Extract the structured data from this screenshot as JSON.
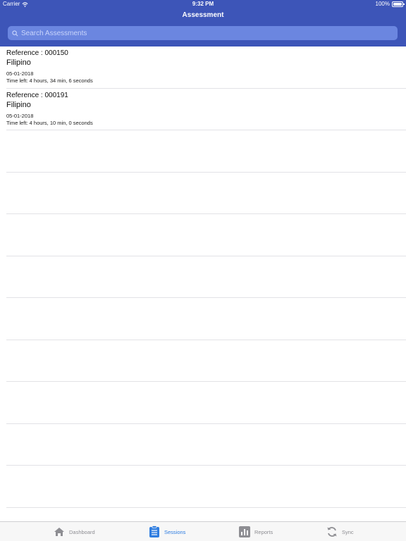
{
  "status": {
    "carrier": "Carrier",
    "time": "9:32 PM",
    "battery": "100%"
  },
  "nav": {
    "title": "Assessment"
  },
  "search": {
    "placeholder": "Search Assessments"
  },
  "assessments": [
    {
      "reference": "Reference :  000150",
      "language": "Filipino",
      "date": "05-01-2018",
      "time_left": "Time left: 4 hours, 34 min, 6 seconds"
    },
    {
      "reference": "Reference :  000191",
      "language": "Filipino",
      "date": "05-01-2018",
      "time_left": "Time left: 4 hours, 10 min, 0 seconds"
    }
  ],
  "tabs": [
    {
      "label": "Dashboard",
      "icon": "home-icon",
      "active": false
    },
    {
      "label": "Sessions",
      "icon": "clipboard-icon",
      "active": true
    },
    {
      "label": "Reports",
      "icon": "bar-chart-icon",
      "active": false
    },
    {
      "label": "Sync",
      "icon": "sync-icon",
      "active": false
    }
  ],
  "colors": {
    "header": "#3d55b8",
    "search_bg": "#6b86e0",
    "tab_active": "#2f7de0",
    "tab_inactive": "#8e8e93"
  }
}
